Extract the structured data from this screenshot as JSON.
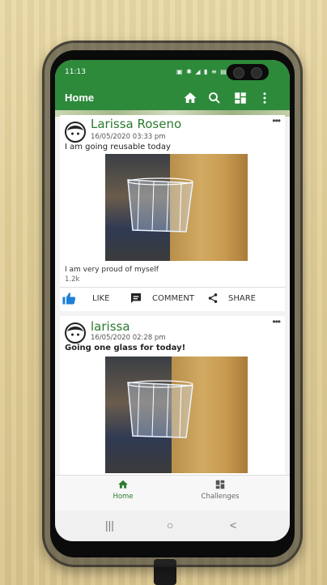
{
  "device_status": {
    "time": "11:13",
    "icons": "▣ ✱ ◢ ▮ ≡ ▤"
  },
  "app_bar": {
    "title": "Home",
    "icons": [
      "home-icon",
      "search-icon",
      "dashboard-icon",
      "more-vert-icon"
    ]
  },
  "posts": [
    {
      "author": "Larissa Roseno",
      "date": "16/05/2020 03:33 pm",
      "text": "I am going reusable today",
      "caption": "I am very proud of myself",
      "likes": "1.2k",
      "more": "•••"
    },
    {
      "author": "larissa",
      "date": "16/05/2020 02:28 pm",
      "text": "Going one glass for today!",
      "more": "•••"
    }
  ],
  "actions": {
    "like": "LIKE",
    "comment": "COMMENT",
    "share": "SHARE"
  },
  "bottom_nav": [
    {
      "label": "Home",
      "icon": "home-icon",
      "active": true
    },
    {
      "label": "Challenges",
      "icon": "dashboard-icon",
      "active": false
    }
  ],
  "system_nav": {
    "recents": "|||",
    "home": "○",
    "back": "<"
  },
  "colors": {
    "primary": "#2d8a3b",
    "accent": "#2d7a2f",
    "like_blue": "#1e7fd6"
  }
}
